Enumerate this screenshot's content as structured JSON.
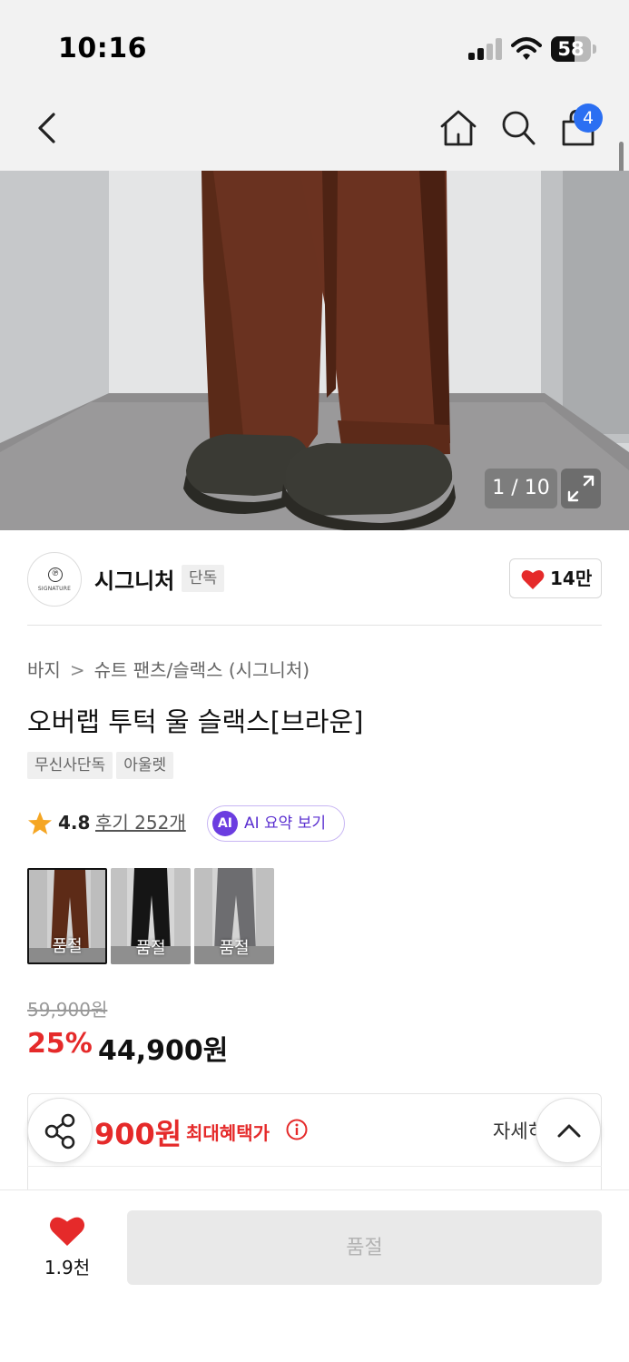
{
  "status_bar": {
    "time": "10:16",
    "battery": "58",
    "battery_level": 0.58
  },
  "nav": {
    "back_icon": "chevron-left-icon",
    "home_icon": "home-icon",
    "search_icon": "search-icon",
    "cart_icon": "shopping-bag-icon",
    "cart_count": "4"
  },
  "gallery": {
    "counter": "1 / 10",
    "expand_icon": "expand-icon"
  },
  "brand": {
    "name": "시그니처",
    "logo_text": "SIGNATURE",
    "tag": "단독",
    "like_count": "14만"
  },
  "breadcrumb": {
    "category": "바지",
    "separator": ">",
    "subcategory": "슈트 팬츠/슬랙스 (시그니처)"
  },
  "product": {
    "title": "오버랩 투턱 울 슬랙스[브라운]",
    "tags": [
      "무신사단독",
      "아울렛"
    ],
    "rating": "4.8",
    "reviews": "후기 252개",
    "ai_badge": "AI",
    "ai_label": "AI 요약 보기"
  },
  "options": [
    {
      "color": "brown",
      "label": "품절",
      "selected": true
    },
    {
      "color": "black",
      "label": "품절",
      "selected": false
    },
    {
      "color": "gray",
      "label": "품절",
      "selected": false
    }
  ],
  "price": {
    "original": "59,900원",
    "discount": "25%",
    "sale": "44,900원"
  },
  "benefit": {
    "amount": "900원",
    "label": "최대혜택가",
    "detail": "자세히"
  },
  "bottom_bar": {
    "favorite_count": "1.9천",
    "buy_label": "품절"
  },
  "colors": {
    "accent_red": "#e52a2a",
    "badge_blue": "#2b6ff2",
    "ai_purple": "#6b3de0",
    "star": "#f5a623"
  }
}
